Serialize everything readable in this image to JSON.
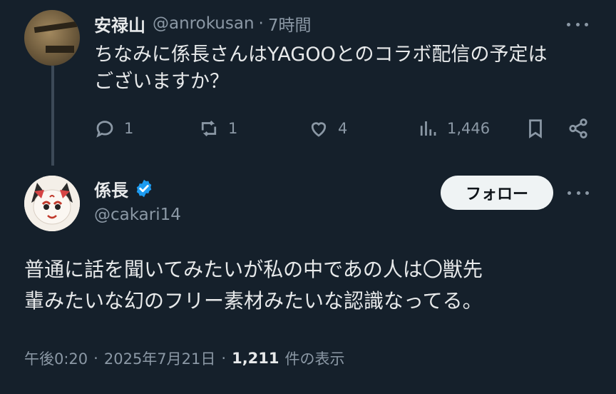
{
  "reply": {
    "name": "安禄山",
    "handle": "@anrokusan",
    "separator": "·",
    "time": "7時間",
    "text_line1": "ちなみに係長さんはYAGOOとのコラボ配信の予定は",
    "text_line2": "ございますか？",
    "actions": {
      "replies": "1",
      "retweets": "1",
      "likes": "4",
      "views": "1,446"
    }
  },
  "main": {
    "name": "係長",
    "handle": "@cakari14",
    "follow_label": "フォロー",
    "text_line1": "普通に話を聞いてみたいが私の中であの人は〇獣先",
    "text_line2": "輩みたいな幻のフリー素材みたいな認識なってる。",
    "time": "午後0:20",
    "date": "2025年7月21日",
    "separator": "·",
    "views_count": "1,211",
    "views_label": "件の表示"
  },
  "colors": {
    "background": "#15202b",
    "primary_text": "#e7e9ea",
    "secondary_text": "#8b98a5",
    "verified": "#1d9bf0",
    "follow_button_bg": "#eff3f4"
  }
}
